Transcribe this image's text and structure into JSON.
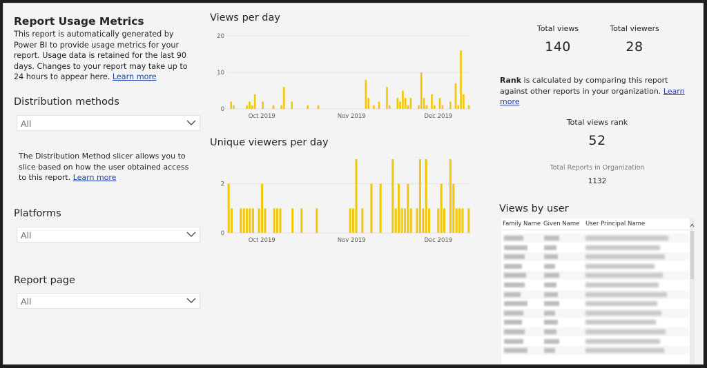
{
  "header": {
    "title": "Report Usage Metrics",
    "description": "This report is automatically generated by Power BI to provide usage metrics for your report. Usage data is retained for the last 90 days. Changes to your report may take up to 24 hours to appear here.",
    "learn_more": "Learn more"
  },
  "slicers": {
    "distribution": {
      "title": "Distribution methods",
      "value": "All"
    },
    "distribution_info": "The Distribution Method slicer allows you to slice based on how the user obtained access to this report.",
    "distribution_learn_more": "Learn more",
    "platforms": {
      "title": "Platforms",
      "value": "All"
    },
    "report_page": {
      "title": "Report page",
      "value": "All"
    }
  },
  "kpis": {
    "total_views_label": "Total views",
    "total_views": "140",
    "total_viewers_label": "Total viewers",
    "total_viewers": "28",
    "rank_bold": "Rank",
    "rank_text": " is calculated by comparing this report against other reports in your organization.",
    "rank_learn_more": "Learn more",
    "views_rank_label": "Total views rank",
    "views_rank": "52",
    "total_reports_label": "Total Reports in Organization",
    "total_reports": "1132"
  },
  "views_by_user": {
    "title": "Views by user",
    "columns": [
      "Family Name",
      "Given Name",
      "User Principal Name"
    ],
    "visible_rows": 13
  },
  "colors": {
    "bar": "#f2c80f",
    "link": "#1f3fa6"
  },
  "chart_data": [
    {
      "type": "bar",
      "title": "Views per day",
      "ylim": [
        0,
        20
      ],
      "yticks": [
        "0",
        "10",
        "20"
      ],
      "xticks": [
        {
          "label": "Oct 2019",
          "day": 12
        },
        {
          "label": "Nov 2019",
          "day": 43
        },
        {
          "label": "Dec 2019",
          "day": 73
        }
      ],
      "days": 84,
      "values": [
        0,
        2,
        1,
        0,
        0,
        0,
        0,
        1,
        2,
        1,
        4,
        0,
        0,
        2,
        0,
        0,
        0,
        1,
        0,
        0,
        1,
        6,
        0,
        0,
        2,
        0,
        0,
        0,
        0,
        0,
        1,
        0,
        0,
        0,
        1,
        0,
        0,
        0,
        0,
        0,
        0,
        0,
        0,
        0,
        0,
        0,
        0,
        0,
        0,
        0,
        0,
        0,
        8,
        3,
        0,
        1,
        0,
        2,
        0,
        0,
        6,
        1,
        0,
        0,
        3,
        2,
        5,
        3,
        1,
        3,
        0,
        0,
        1,
        10,
        3,
        1,
        0,
        4,
        1,
        0,
        3,
        1,
        0,
        0,
        2,
        0,
        7,
        1,
        16,
        4,
        0,
        1
      ]
    },
    {
      "type": "bar",
      "title": "Unique viewers per day",
      "ylim": [
        0,
        3
      ],
      "yticks": [
        "0",
        "2"
      ],
      "xticks": [
        {
          "label": "Oct 2019",
          "day": 12
        },
        {
          "label": "Nov 2019",
          "day": 43
        },
        {
          "label": "Dec 2019",
          "day": 73
        }
      ],
      "days": 84,
      "values": [
        2,
        1,
        0,
        0,
        1,
        1,
        1,
        1,
        1,
        0,
        1,
        2,
        1,
        0,
        0,
        1,
        1,
        1,
        0,
        0,
        0,
        1,
        0,
        0,
        1,
        0,
        0,
        0,
        0,
        1,
        0,
        0,
        0,
        0,
        0,
        0,
        0,
        0,
        0,
        0,
        1,
        1,
        3,
        0,
        1,
        0,
        0,
        2,
        0,
        0,
        2,
        0,
        0,
        0,
        3,
        1,
        2,
        1,
        1,
        2,
        1,
        0,
        1,
        3,
        1,
        3,
        1,
        0,
        0,
        1,
        2,
        1,
        0,
        3,
        2,
        1,
        1,
        1,
        0,
        1
      ]
    }
  ]
}
